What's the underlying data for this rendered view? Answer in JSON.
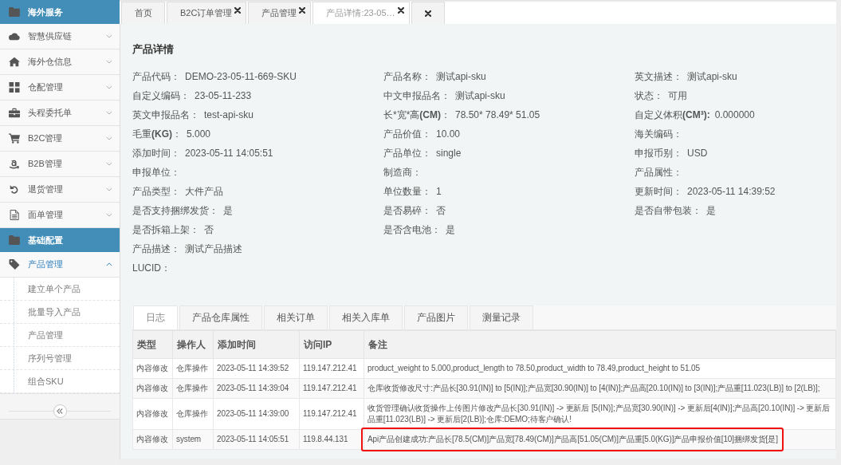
{
  "sidebar": {
    "sections": [
      {
        "title": "海外服务",
        "items": [
          {
            "label": "智慧供应链",
            "expanded": false
          },
          {
            "label": "海外仓信息",
            "expanded": false
          },
          {
            "label": "仓配管理",
            "expanded": false
          },
          {
            "label": "头程委托单",
            "expanded": false
          },
          {
            "label": "B2C管理",
            "expanded": false
          },
          {
            "label": "B2B管理",
            "expanded": false
          },
          {
            "label": "退货管理",
            "expanded": false
          },
          {
            "label": "面单管理",
            "expanded": false
          }
        ]
      },
      {
        "title": "基础配置",
        "items": [
          {
            "label": "产品管理",
            "expanded": true,
            "children": [
              {
                "label": "建立单个产品"
              },
              {
                "label": "批量导入产品"
              },
              {
                "label": "产品管理"
              },
              {
                "label": "序列号管理"
              },
              {
                "label": "组合SKU"
              }
            ]
          }
        ]
      }
    ]
  },
  "tabs": {
    "items": [
      {
        "label": "首页",
        "closable": false,
        "selected": false
      },
      {
        "label": "B2C订单管理",
        "closable": true,
        "selected": false
      },
      {
        "label": "产品管理",
        "closable": true,
        "selected": false
      },
      {
        "label": "产品详情:23-05…",
        "closable": true,
        "selected": true
      }
    ],
    "close_all": true
  },
  "detail": {
    "title": "产品详情",
    "rows": [
      [
        {
          "label": "产品代码：",
          "value": "DEMO-23-05-11-669-SKU"
        },
        {
          "label": "产品名称：",
          "value": "测试api-sku"
        },
        {
          "label": "英文描述：",
          "value": "测试api-sku"
        }
      ],
      [
        {
          "label": "自定义编码：",
          "value": "23-05-11-233"
        },
        {
          "label": "中文申报品名：",
          "value": "测试api-sku"
        },
        {
          "label": "状态：",
          "value": "可用"
        }
      ],
      [
        {
          "label": "英文申报品名：",
          "value": "test-api-sku"
        },
        {
          "label": "长*宽*高**(CM)**：",
          "value": "78.50* 78.49* 51.05"
        },
        {
          "label": "自定义体积**(CM³):**",
          "value": "0.000000"
        }
      ],
      [
        {
          "label": "毛重**(KG)**：",
          "value": "5.000"
        },
        {
          "label": "产品价值：",
          "value": "10.00"
        },
        {
          "label": "海关编码："
        }
      ],
      [
        {
          "label": "添加时间：",
          "value": "2023-05-11 14:05:51"
        },
        {
          "label": "产品单位：",
          "value": "single"
        },
        {
          "label": "申报币别：",
          "value": "USD"
        }
      ],
      [
        {
          "label": "申报单位："
        },
        {
          "label": "制造商："
        },
        {
          "label": "产品属性："
        }
      ],
      [
        {
          "label": "产品类型：",
          "value": "大件产品"
        },
        {
          "label": "单位数量：",
          "value": "1"
        },
        {
          "label": "更新时间：",
          "value": "2023-05-11 14:39:52"
        }
      ],
      [
        {
          "label": "是否支持捆绑发货：",
          "value": "是"
        },
        {
          "label": "是否易碎：",
          "value": "否"
        },
        {
          "label": "是否自带包装：",
          "value": "是"
        }
      ],
      [
        {
          "label": "是否拆箱上架：",
          "value": "否"
        },
        {
          "label": "是否含电池：",
          "value": "是"
        }
      ],
      [
        {
          "label": "产品描述：",
          "value": "测试产品描述"
        }
      ],
      [
        {
          "label": "LUCID："
        }
      ]
    ]
  },
  "log_tabs": [
    {
      "label": "日志",
      "selected": true
    },
    {
      "label": "产品仓库属性",
      "selected": false
    },
    {
      "label": "相关订单",
      "selected": false
    },
    {
      "label": "相关入库单",
      "selected": false
    },
    {
      "label": "产品图片",
      "selected": false
    },
    {
      "label": "测量记录",
      "selected": false
    }
  ],
  "log_table": {
    "columns": [
      "类型",
      "操作人",
      "添加时间",
      "访问IP",
      "备注"
    ],
    "rows": [
      {
        "cells": [
          "内容修改",
          "仓库操作",
          "2023-05-11 14:39:52",
          "119.147.212.41"
        ],
        "remark": [
          "product_weight to 5.000,product_length to 78.50,product_width to 78.49,product_height to 51.05"
        ],
        "highlighted": false
      },
      {
        "cells": [
          "内容修改",
          "仓库操作",
          "2023-05-11 14:39:04",
          "119.147.212.41"
        ],
        "remark": [
          "仓库收货修改尺寸:产品长[30.91(IN)] to [5(IN)];产品宽[30.90(IN)] to [4(IN)];产品高[20.10(IN)] to [3(IN)];产品重[11.023(LB)] to [2(LB)];"
        ],
        "highlighted": false
      },
      {
        "cells": [
          "内容修改",
          "仓库操作",
          "2023-05-11 14:39:00",
          "119.147.212.41"
        ],
        "remark": [
          "收货管理确认收货操作上传图片修改产品长[30.91(IN)] -> 更新后 [5(IN)];产品宽[30.90(IN)] -> 更新后[4(IN)];产品高[20.10(IN)] -> 更新后",
          "品重[11.023(LB)] -> 更新后[2(LB)];仓库:DEMO;待客户确认!"
        ],
        "highlighted": false
      },
      {
        "cells": [
          "内容修改",
          "system",
          "2023-05-11 14:05:51",
          "119.8.44.131"
        ],
        "remark": [
          "Api产品创建成功:产品长[78.5(CM)]产品宽[78.49(CM)]产品高[51.05(CM)]产品重[5.0(KG)]产品申报价值[10]捆绑发货[是]"
        ],
        "highlighted": true
      }
    ]
  }
}
